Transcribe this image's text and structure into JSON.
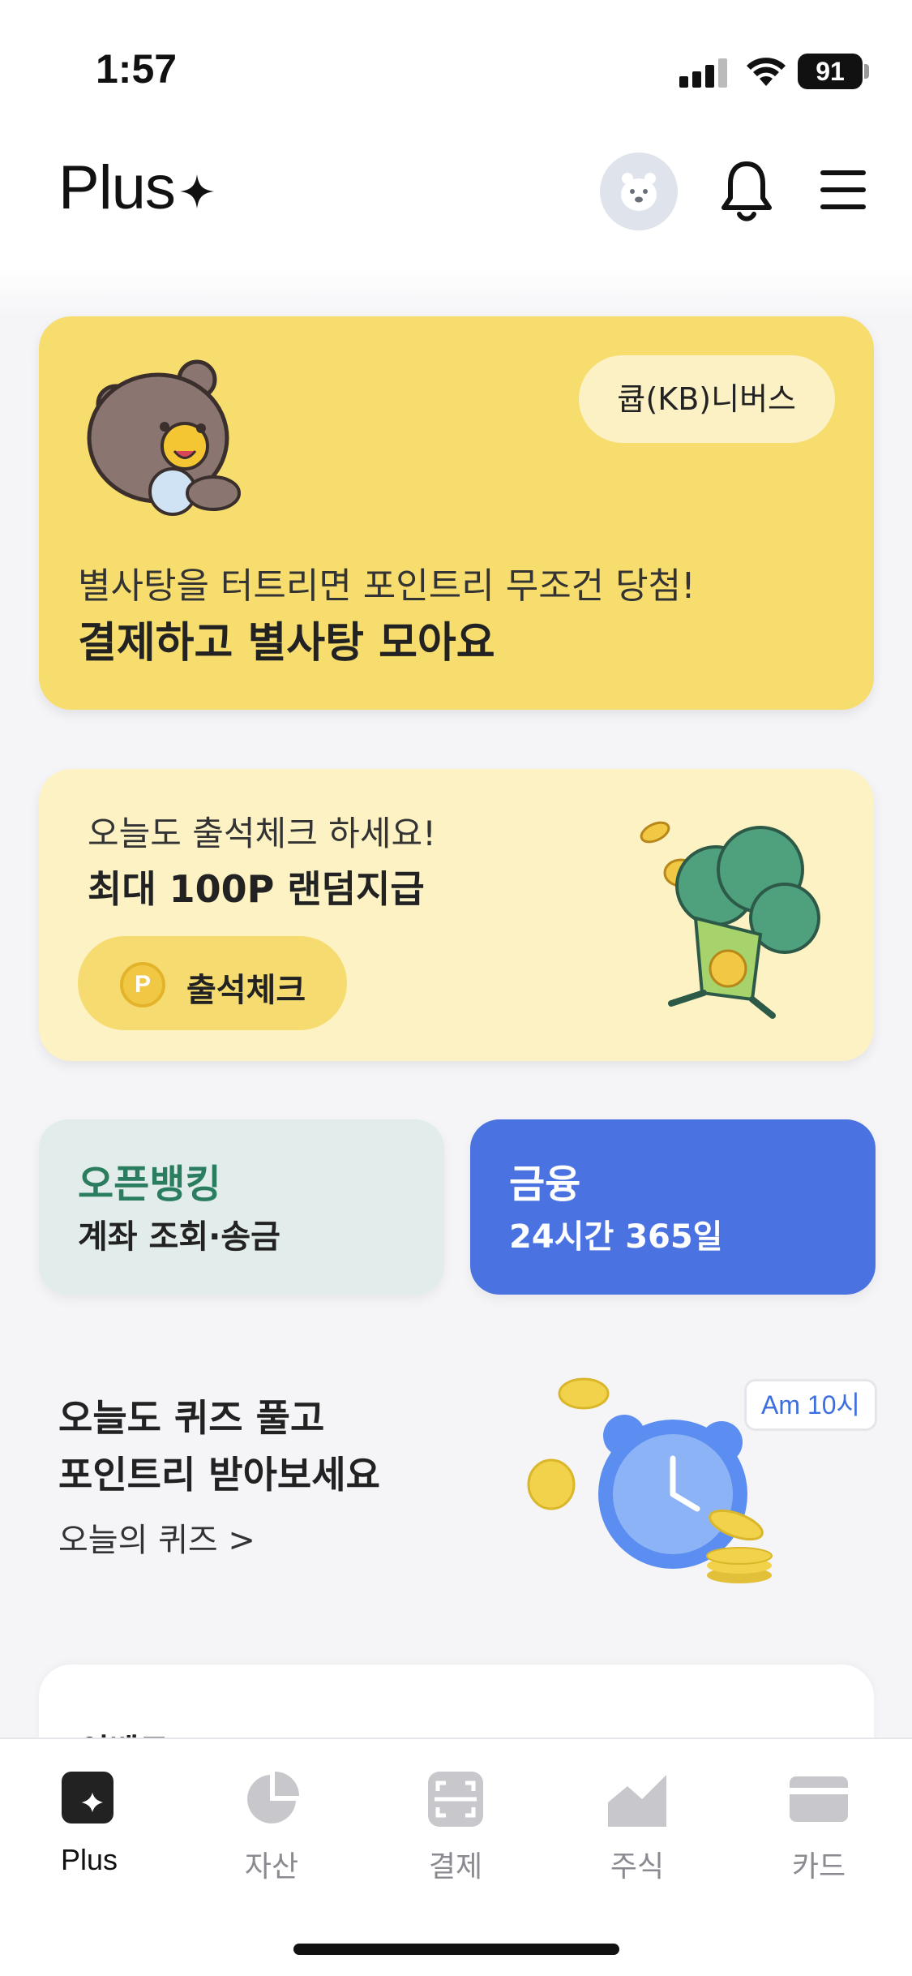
{
  "status_bar": {
    "time": "1:57",
    "battery": "91"
  },
  "header": {
    "logo": "Plus"
  },
  "promo_card": {
    "badge": "큡(KB)니버스",
    "subtitle": "별사탕을 터트리면 포인트리 무조건 당첨!",
    "title": "결제하고 별사탕 모아요"
  },
  "attendance_card": {
    "subtitle": "오늘도 출석체크 하세요!",
    "title": "최대 100P 랜덤지급",
    "button_label": "출석체크",
    "coin_letter": "P"
  },
  "tiles": {
    "open_banking": {
      "title": "오픈뱅킹",
      "subtitle": "계좌 조회·송금"
    },
    "finance": {
      "title": "금융",
      "subtitle": "24시간 365일"
    }
  },
  "quiz": {
    "line1": "오늘도 퀴즈 풀고",
    "line2": "포인트리 받아보세요",
    "link": "오늘의 퀴즈 >",
    "bubble": "Am 10시"
  },
  "event": {
    "title": "이벤트"
  },
  "tab_bar": {
    "items": [
      {
        "label": "Plus",
        "icon": "plus-sparkle-icon"
      },
      {
        "label": "자산",
        "icon": "pie-chart-icon"
      },
      {
        "label": "결제",
        "icon": "scan-icon"
      },
      {
        "label": "주식",
        "icon": "stock-chart-icon"
      },
      {
        "label": "카드",
        "icon": "card-icon"
      }
    ]
  },
  "colors": {
    "promo_yellow": "#f7dd6e",
    "attendance_yellow": "#fcf2c4",
    "open_banking_bg": "#e2ecea",
    "open_banking_text": "#2b7d5f",
    "finance_blue": "#4a72e0"
  }
}
